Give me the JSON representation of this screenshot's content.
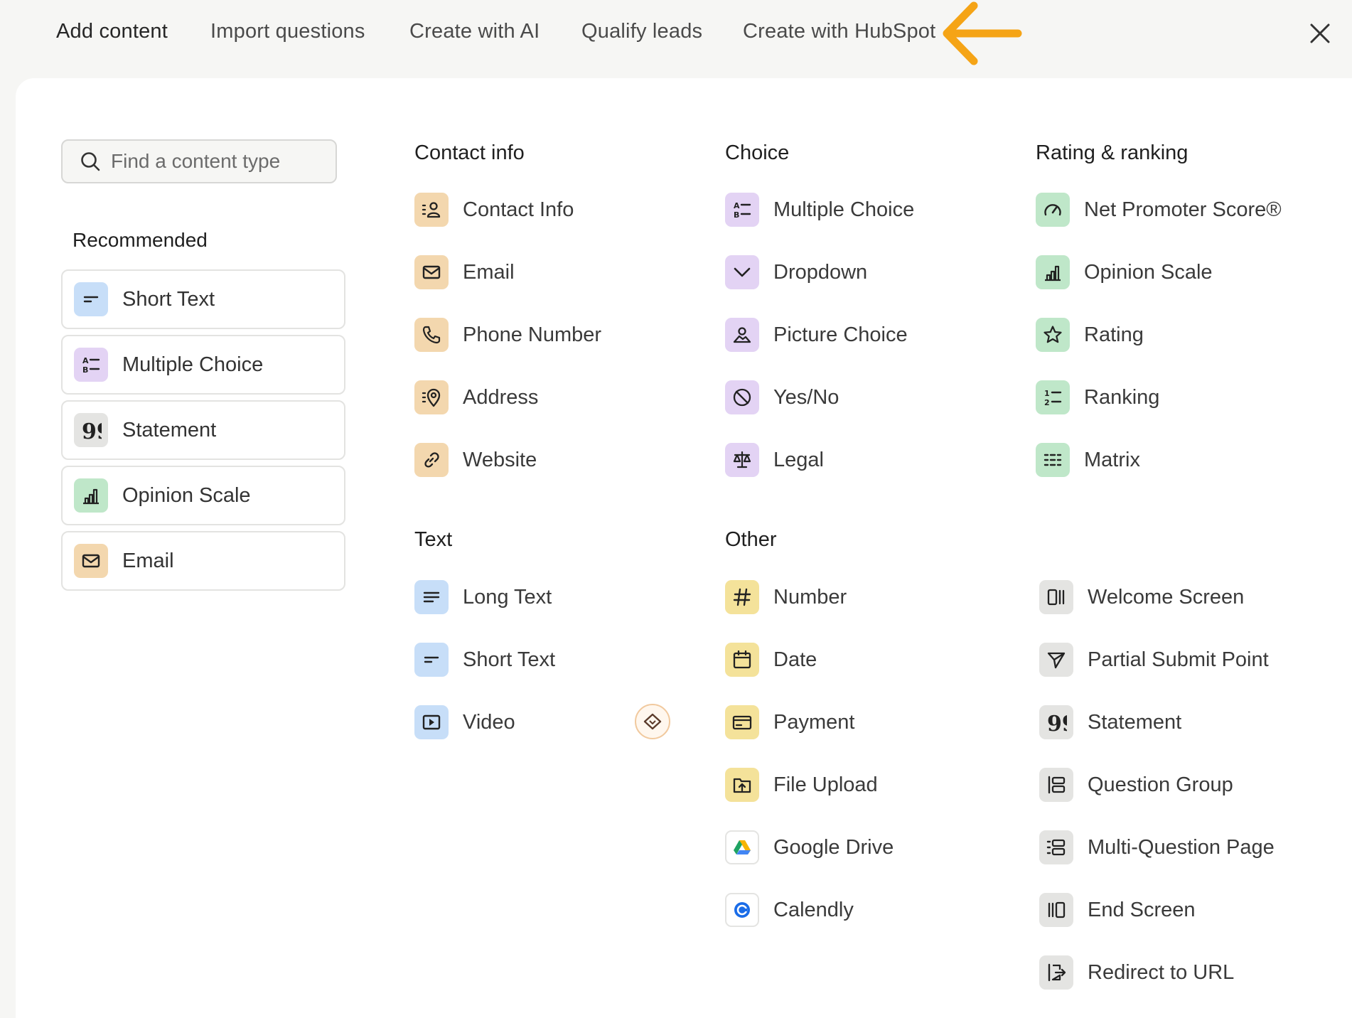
{
  "tabs": [
    {
      "label": "Add content",
      "active": true
    },
    {
      "label": "Import questions",
      "active": false
    },
    {
      "label": "Create with AI",
      "active": false
    },
    {
      "label": "Qualify leads",
      "active": false
    },
    {
      "label": "Create with HubSpot",
      "active": false
    }
  ],
  "search": {
    "placeholder": "Find a content type",
    "value": ""
  },
  "recommended": {
    "title": "Recommended",
    "items": [
      {
        "label": "Short Text",
        "icon": "short-text-icon"
      },
      {
        "label": "Multiple Choice",
        "icon": "multiple-choice-icon"
      },
      {
        "label": "Statement",
        "icon": "quote-icon"
      },
      {
        "label": "Opinion Scale",
        "icon": "bar-chart-icon"
      },
      {
        "label": "Email",
        "icon": "envelope-icon"
      }
    ]
  },
  "contact_info": {
    "title": "Contact info",
    "items": [
      {
        "label": "Contact Info",
        "icon": "contact-card-icon"
      },
      {
        "label": "Email",
        "icon": "envelope-icon"
      },
      {
        "label": "Phone Number",
        "icon": "phone-icon"
      },
      {
        "label": "Address",
        "icon": "map-pin-icon"
      },
      {
        "label": "Website",
        "icon": "link-icon"
      }
    ]
  },
  "choice": {
    "title": "Choice",
    "items": [
      {
        "label": "Multiple Choice",
        "icon": "multiple-choice-icon"
      },
      {
        "label": "Dropdown",
        "icon": "chevron-down-icon"
      },
      {
        "label": "Picture Choice",
        "icon": "picture-icon"
      },
      {
        "label": "Yes/No",
        "icon": "yes-no-icon"
      },
      {
        "label": "Legal",
        "icon": "scales-icon"
      }
    ]
  },
  "rating": {
    "title": "Rating & ranking",
    "items": [
      {
        "label": "Net Promoter Score®",
        "icon": "gauge-icon"
      },
      {
        "label": "Opinion Scale",
        "icon": "bar-chart-icon"
      },
      {
        "label": "Rating",
        "icon": "star-icon"
      },
      {
        "label": "Ranking",
        "icon": "ordered-list-icon"
      },
      {
        "label": "Matrix",
        "icon": "matrix-icon"
      }
    ]
  },
  "text": {
    "title": "Text",
    "items": [
      {
        "label": "Long Text",
        "icon": "long-text-icon"
      },
      {
        "label": "Short Text",
        "icon": "short-text-icon"
      },
      {
        "label": "Video",
        "icon": "video-icon"
      }
    ]
  },
  "other": {
    "title": "Other",
    "items": [
      {
        "label": "Number",
        "icon": "hash-icon"
      },
      {
        "label": "Date",
        "icon": "calendar-icon"
      },
      {
        "label": "Payment",
        "icon": "credit-card-icon"
      },
      {
        "label": "File Upload",
        "icon": "folder-upload-icon"
      },
      {
        "label": "Google Drive",
        "icon": "google-drive-icon"
      },
      {
        "label": "Calendly",
        "icon": "calendly-icon"
      }
    ]
  },
  "structure": {
    "items": [
      {
        "label": "Welcome Screen",
        "icon": "welcome-screen-icon"
      },
      {
        "label": "Partial Submit Point",
        "icon": "send-icon"
      },
      {
        "label": "Statement",
        "icon": "quote-icon"
      },
      {
        "label": "Question Group",
        "icon": "question-group-icon"
      },
      {
        "label": "Multi-Question Page",
        "icon": "multi-question-icon"
      },
      {
        "label": "End Screen",
        "icon": "end-screen-icon"
      },
      {
        "label": "Redirect to URL",
        "icon": "redirect-icon"
      }
    ]
  },
  "colors": {
    "contact": "#f3d7ae",
    "choice": "#e3d3f4",
    "rating": "#bfe7c9",
    "text": "#c7def8",
    "other": "#f4e29a",
    "structure": "#e4e4e2",
    "arrow": "#f5a416"
  }
}
